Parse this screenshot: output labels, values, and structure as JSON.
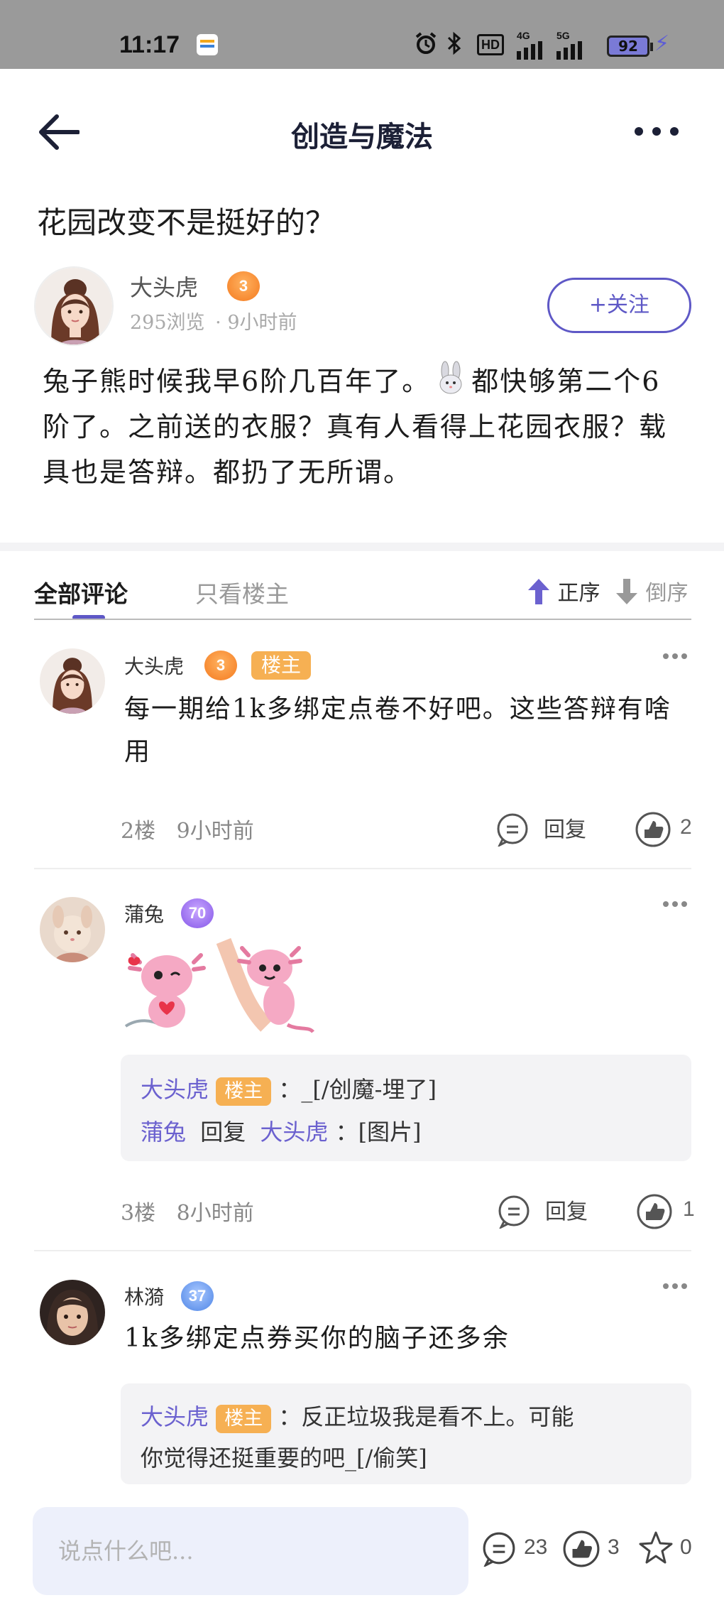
{
  "status_bar": {
    "time": "11:17",
    "battery": "92",
    "icons": [
      "alarm-icon",
      "bluetooth-icon",
      "hd-icon",
      "4g-signal-icon",
      "5g-signal-icon",
      "battery-icon",
      "charging-icon"
    ],
    "hd": "HD",
    "net1": "4G",
    "net2": "5G"
  },
  "header": {
    "title": "创造与魔法"
  },
  "post": {
    "title": "花园改变不是挺好的？",
    "author": "大头虎",
    "author_level": "3",
    "meta_views": "295浏览",
    "meta_time": "9小时前",
    "follow_label": "+关注",
    "body_part1": "兔子熊时候我早6阶几百年了。",
    "body_part2": "都快够第二个6阶了。之前送的衣服？真有人看得上花园衣服？载具也是答辩。都扔了无所谓。"
  },
  "tabs": {
    "all": "全部评论",
    "op_only": "只看楼主",
    "asc": "正序",
    "desc": "倒序"
  },
  "comments": [
    {
      "name": "大头虎",
      "level": "3",
      "badge": "楼主",
      "text": "每一期给1k多绑定点卷不好吧。这些答辩有啥用",
      "floor": "2楼",
      "time": "9小时前",
      "reply_label": "回复",
      "likes": "2"
    },
    {
      "name": "蒲兔",
      "level": "70",
      "floor": "3楼",
      "time": "8小时前",
      "reply_label": "回复",
      "likes": "1",
      "replies": [
        {
          "from": "大头虎",
          "badge": "楼主",
          "text": "：_[/创魔-埋了]"
        },
        {
          "from": "蒲兔",
          "verb": "回复",
          "to": "大头虎",
          "text": "：[图片]"
        }
      ]
    },
    {
      "name": "林漪",
      "level": "37",
      "text": "1k多绑定点券买你的脑子还多余",
      "replies": [
        {
          "from": "大头虎",
          "badge": "楼主",
          "text_line1": "：反正垃圾我是看不上。可能",
          "text_line2": "你觉得还挺重要的吧_[/偷笑]"
        }
      ]
    }
  ],
  "bottom_bar": {
    "placeholder": "说点什么吧...",
    "comments": "23",
    "likes": "3",
    "favorites": "0"
  },
  "colors": {
    "accent": "#5e58c6",
    "op_badge": "#f6b053",
    "reply_name": "#6b61cf"
  }
}
